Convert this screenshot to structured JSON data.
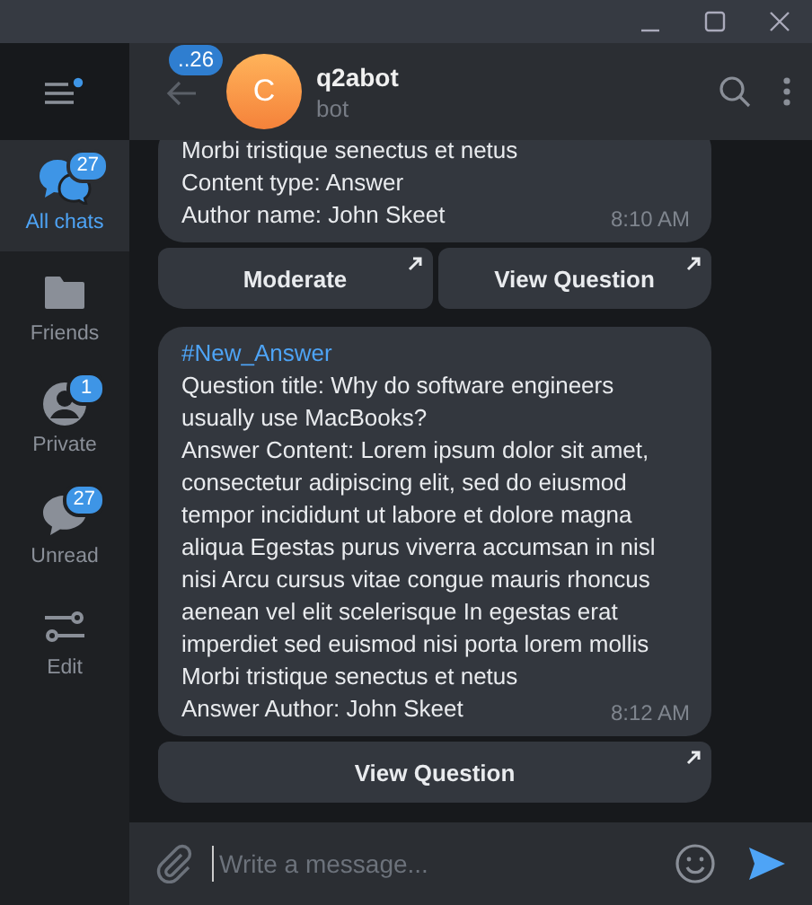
{
  "sidebar": {
    "items": [
      {
        "kind": "chats",
        "label": "All chats",
        "badge": "27",
        "selected": true
      },
      {
        "kind": "folder",
        "label": "Friends",
        "selected": false
      },
      {
        "kind": "person",
        "label": "Private",
        "badge": "1",
        "selected": false
      },
      {
        "kind": "bubble",
        "label": "Unread",
        "badge": "27",
        "selected": false
      },
      {
        "kind": "edit",
        "label": "Edit",
        "selected": false
      }
    ]
  },
  "header": {
    "back_badge": "..26",
    "avatar_letter": "C",
    "name": "q2abot",
    "status": "bot"
  },
  "messages": [
    {
      "lines": [
        "Morbi tristique senectus et netus",
        "Content type: Answer",
        "Author name: John Skeet"
      ],
      "time": "8:10 AM",
      "buttons": [
        [
          "Moderate",
          "View Question"
        ]
      ]
    },
    {
      "hashtag": "#New_Answer",
      "lines": [
        "Question title: Why do software engineers usually use MacBooks?",
        "Answer Content: Lorem ipsum dolor sit amet, consectetur adipiscing elit, sed do eiusmod tempor incididunt ut labore et dolore magna aliqua Egestas purus viverra accumsan in nisl nisi Arcu cursus vitae congue mauris rhoncus aenean vel elit scelerisque In egestas erat imperdiet sed euismod nisi porta lorem mollis Morbi tristique senectus et netus",
        "Answer Author: John Skeet"
      ],
      "time": "8:12 AM",
      "buttons": [
        [
          "View Question"
        ]
      ]
    }
  ],
  "composer": {
    "placeholder": "Write a message..."
  }
}
